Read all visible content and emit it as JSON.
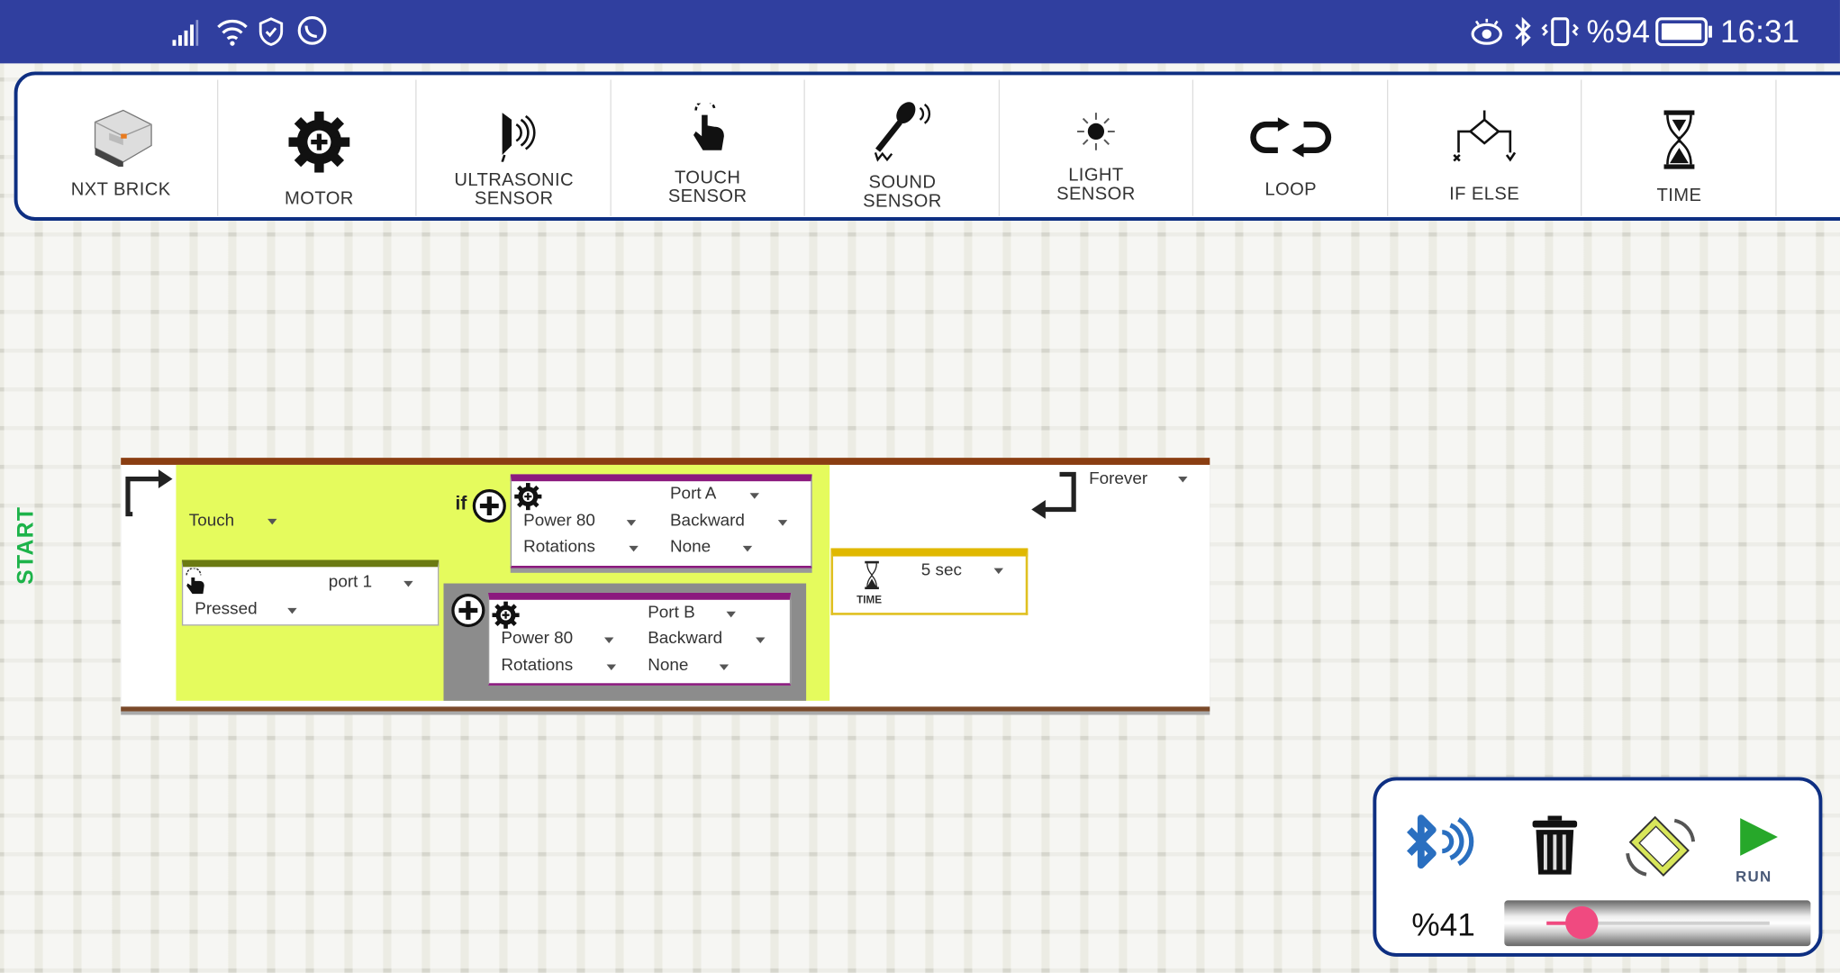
{
  "status_bar": {
    "time": "16:31",
    "battery": "%94",
    "left_icons": [
      "signal-icon",
      "wifi-icon",
      "shield-check-icon",
      "whatsapp-icon"
    ],
    "right_icons": [
      "eye-icon",
      "bluetooth-icon",
      "vibrate-icon",
      "battery-icon"
    ],
    "color": "#303f9f"
  },
  "toolbar": {
    "items": [
      {
        "label1": "NXT BRICK",
        "label2": "",
        "icon": "nxt-brick-icon"
      },
      {
        "label1": "MOTOR",
        "label2": "",
        "icon": "gear-icon"
      },
      {
        "label1": "ULTRASONIC",
        "label2": "SENSOR",
        "icon": "ultrasonic-icon"
      },
      {
        "label1": "TOUCH",
        "label2": "SENSOR",
        "icon": "touch-hand-icon"
      },
      {
        "label1": "SOUND",
        "label2": "SENSOR",
        "icon": "microphone-icon"
      },
      {
        "label1": "LIGHT",
        "label2": "SENSOR",
        "icon": "light-icon"
      },
      {
        "label1": "LOOP",
        "label2": "",
        "icon": "loop-icon"
      },
      {
        "label1": "IF ELSE",
        "label2": "",
        "icon": "if-else-icon"
      },
      {
        "label1": "TIME",
        "label2": "",
        "icon": "hourglass-icon"
      }
    ],
    "border_color": "#0e2f82"
  },
  "canvas": {
    "start_label": "START",
    "loop": {
      "mode": "Forever"
    },
    "condition": {
      "sensor": "Touch",
      "if_label": "if",
      "touch_block": {
        "port": "port 1",
        "state": "Pressed"
      }
    },
    "motor_a": {
      "port": "Port A",
      "power": "Power 80",
      "direction": "Backward",
      "unit": "Rotations",
      "amount": "None"
    },
    "motor_b": {
      "port": "Port B",
      "power": "Power 80",
      "direction": "Backward",
      "unit": "Rotations",
      "amount": "None"
    },
    "time_block": {
      "value": "5 sec",
      "label": "TIME"
    },
    "colors": {
      "condition_bg": "#e5fb5d",
      "else_bg": "#8c8c8c",
      "motor_bar": "#8b1a7e",
      "touch_bar": "#6b7a12",
      "time_bar": "#e0b800",
      "loop_border": "#8a3e12"
    }
  },
  "control_panel": {
    "speed_label": "%41",
    "speed_value": 41,
    "run_label": "RUN",
    "buttons": [
      "bluetooth-connect-icon",
      "trash-icon",
      "rotate-screen-icon",
      "run-icon"
    ]
  }
}
